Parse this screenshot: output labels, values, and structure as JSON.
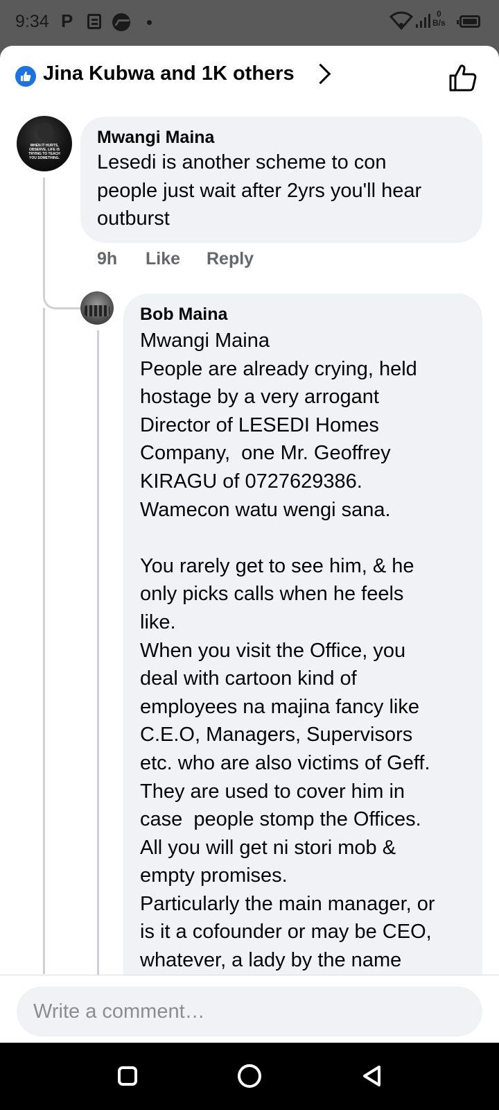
{
  "status_bar": {
    "time": "9:34",
    "carrier_icon_text": "P",
    "net_speed_value": "0",
    "net_speed_unit": "B/s"
  },
  "header": {
    "reactions_text": "Jina Kubwa and 1K others",
    "accent": "#1b74e4"
  },
  "comments": [
    {
      "author": "Mwangi Maina",
      "avatar_text": "WHEN IT HURTS, OBSERVE. LIFE IS TRYING TO TEACH YOU SOMETHING.",
      "text": "Lesedi is another scheme to con\npeople just wait after 2yrs you'll hear\noutburst",
      "time": "9h",
      "like_label": "Like",
      "reply_label": "Reply"
    },
    {
      "author": "Bob Maina",
      "text": "Mwangi Maina\nPeople are already crying, held\nhostage by a very arrogant\nDirector of LESEDI Homes\nCompany,  one Mr. Geoffrey\nKIRAGU of 0727629386.\nWamecon watu wengi sana.\n\nYou rarely get to see him, & he\nonly picks calls when he feels\nlike.\nWhen you visit the Office, you\ndeal with cartoon kind of\nemployees na majina fancy like\nC.E.O, Managers, Supervisors\netc. who are also victims of Geff.\nThey are used to cover him in\ncase  people stomp the Offices.\nAll you will get ni stori mob &\nempty promises.\nParticularly the main manager, or\nis it a cofounder or may be CEO,\nwhatever, a lady by the name"
    }
  ],
  "composer": {
    "placeholder": "Write a comment…"
  }
}
